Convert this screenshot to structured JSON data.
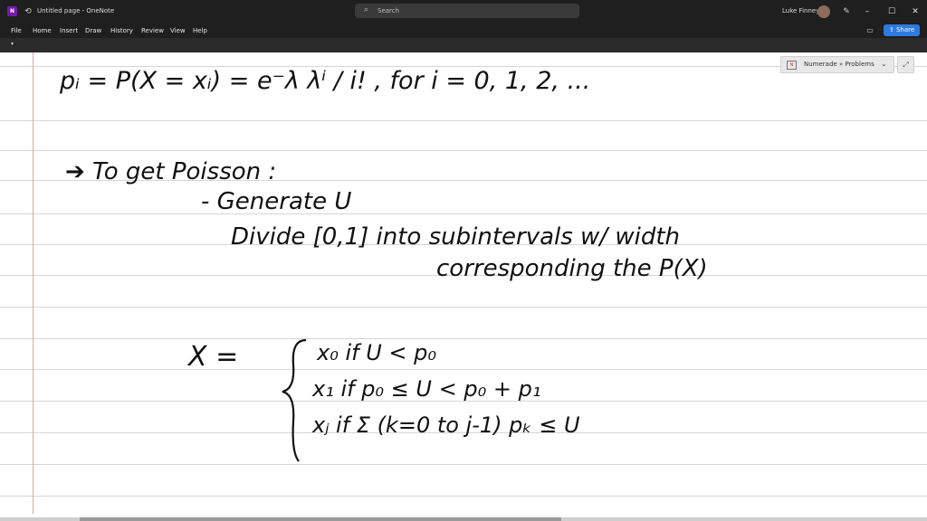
{
  "window": {
    "title": "Untitled page - OneNote",
    "search_placeholder": "Search",
    "user_name": "Luke Finney",
    "minimize": "–",
    "maximize": "☐",
    "close": "✕"
  },
  "menu": {
    "items": [
      "File",
      "Home",
      "Insert",
      "Draw",
      "History",
      "Review",
      "View",
      "Help"
    ],
    "share_label": "Share"
  },
  "notebook_picker": {
    "label": "Numerade » Problems"
  },
  "ink": {
    "line1": "pᵢ = P(X = xᵢ) = e⁻λ λⁱ / i!   ,  for  i = 0, 1, 2, ...",
    "line2": "➔ To get Poisson :",
    "line3": "- Generate U",
    "line4": "Divide [0,1] into subintervals w/ width",
    "line5": "corresponding the P(X)",
    "case_lhs": "X =",
    "case1": "x₀    if   U < p₀",
    "case2": "x₁    if   p₀ ≤ U < p₀ + p₁",
    "case3": "xⱼ    if   Σ (k=0 to j-1) pₖ ≤ U"
  },
  "colors": {
    "titlebar": "#1f1f1f",
    "ribbon": "#2b2b2b",
    "share": "#2d7ae0",
    "app_icon": "#7719aa",
    "margin_line": "#e8a0a0",
    "rule_line": "#d6d6d6"
  }
}
